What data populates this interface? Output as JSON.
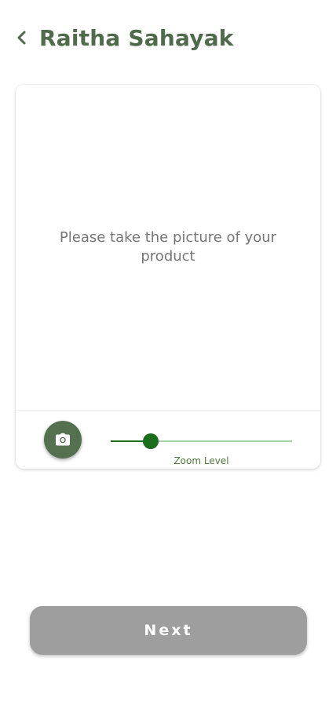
{
  "header": {
    "back_icon": "chevron-left-icon",
    "title": "Raitha Sahayak"
  },
  "camera_card": {
    "message": "Please take the picture of your product",
    "capture_icon": "camera-icon",
    "zoom": {
      "label": "Zoom Level",
      "value_fraction": 0.22
    }
  },
  "footer": {
    "next_label": "Next"
  },
  "colors": {
    "brand_green": "#4f6b4c",
    "camera_button": "#55704f",
    "slider_active": "#1b6e1b",
    "slider_inactive": "#a9cfa9",
    "next_button_disabled": "#9e9e9e"
  }
}
